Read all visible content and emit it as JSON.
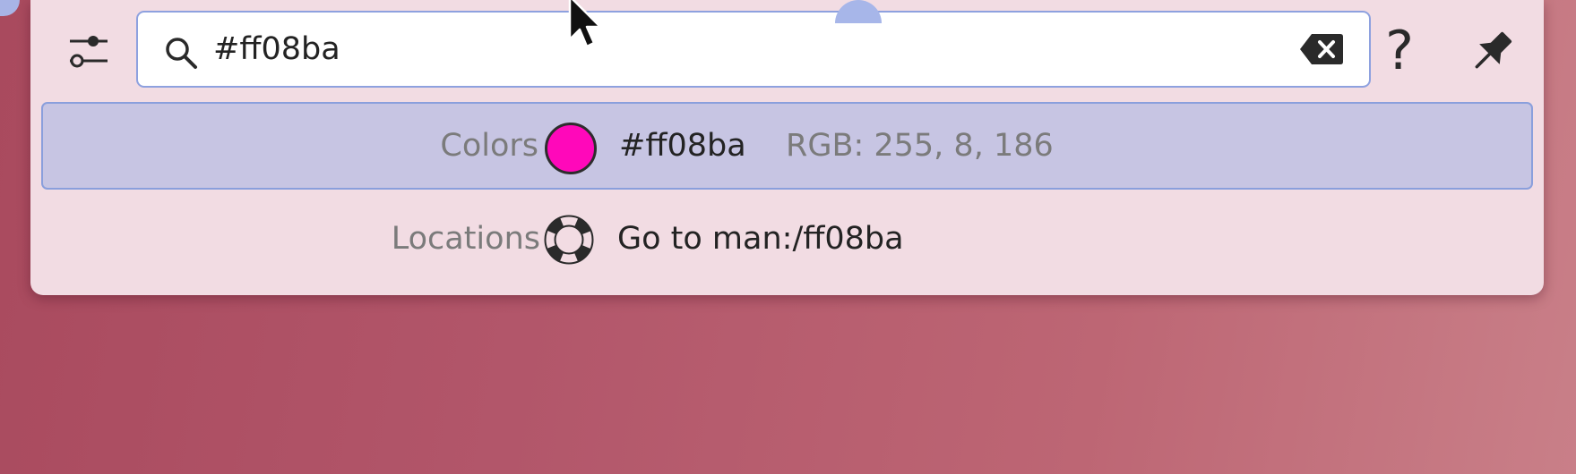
{
  "search": {
    "query": "#ff08ba"
  },
  "results": [
    {
      "category": "Colors",
      "icon": "color-swatch-icon",
      "swatch_color": "#ff08ba",
      "title": "#ff08ba",
      "subtitle": "RGB: 255, 8, 186",
      "selected": true
    },
    {
      "category": "Locations",
      "icon": "help-lifebuoy-icon",
      "title": "Go to man:/ff08ba",
      "subtitle": "",
      "selected": false
    }
  ],
  "toolbar": {
    "help_glyph": "?",
    "config_icon": "sliders-icon",
    "pin_icon": "pin-icon",
    "clear_icon": "clear-text-icon"
  },
  "colors": {
    "panel": "#f2dce3",
    "selection": "#c7c5e3",
    "accent": "#8a9fdc",
    "swatch": "#ff08ba"
  }
}
